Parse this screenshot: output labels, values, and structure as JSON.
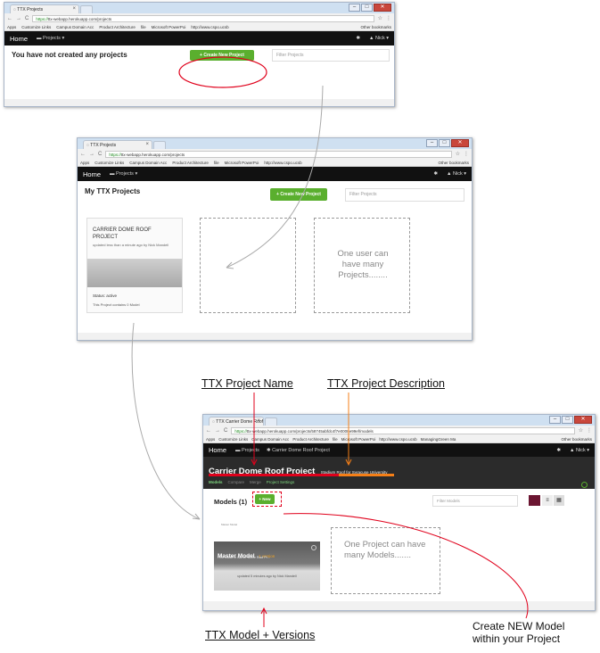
{
  "screen1": {
    "tab_title": "TTX Projects",
    "url_secure": "https://",
    "url_rest": "ttx-webapp.herokuapp.com/projects",
    "bookmarks": [
      "Apps",
      "Customize Links",
      "Campus Domain Acc",
      "Product Architecture",
      "file",
      "Microsoft PowerPoi",
      "http://www.cspo.ucsb"
    ],
    "other_bookmarks": "Other bookmarks",
    "nav_home": "Home",
    "nav_projects": "Projects",
    "nav_user": "Nick",
    "heading": "You have not created any projects",
    "create_btn": "+ Create New Project",
    "filter_placeholder": "Filter Projects"
  },
  "screen2": {
    "tab_title": "TTX Projects",
    "url_secure": "https://",
    "url_rest": "ttx-webapp.herokuapp.com/projects",
    "bookmarks": [
      "Apps",
      "Customize Links",
      "Campus Domain Acc",
      "Product Architecture",
      "file",
      "Microsoft PowerPoi",
      "http://www.cspo.ucsb"
    ],
    "other_bookmarks": "Other bookmarks",
    "nav_home": "Home",
    "nav_projects": "Projects",
    "nav_user": "Nick",
    "heading": "My TTX Projects",
    "create_btn": "+ Create New Project",
    "filter_placeholder": "Filter Projects",
    "card_title": "CARRIER DOME ROOF PROJECT",
    "card_sub": "updated less than a minute ago by Nick Mandell",
    "card_status": "Status: active",
    "card_count": "This Project contains 0 Model",
    "note": "One user can have many Projects........"
  },
  "screen3": {
    "tab_title": "TTX Carrier Dome Roof",
    "url_secure": "https://",
    "url_rest": "ttx-webapp.herokuapp.com/projects/58745abfdc4f7e0008e99ef/models",
    "bookmarks": [
      "Apps",
      "Customize Links",
      "Campus Domain Acc",
      "Product Architecture",
      "file",
      "Microsoft PowerPoi",
      "http://www.cspo.ucsb",
      "ManagingGreen Ma"
    ],
    "other_bookmarks": "Other bookmarks",
    "nav_home": "Home",
    "nav_projects": "Projects",
    "nav_crumb": "Carrier Dome Roof Project",
    "nav_user": "Nick",
    "project_name": "Carrier Dome Roof Project",
    "project_desc": "Stadium Roof for Syracuse University",
    "subnav": [
      "Models",
      "Compare",
      "Merge",
      "Project Settings"
    ],
    "models_heading": "Models (1)",
    "new_btn": "+ New",
    "filter_placeholder": "Filter Models",
    "mini_text": "Master Model",
    "model_title": "Master Model",
    "model_badge": "1 version",
    "model_desc": "First Model in Carrier Dome Roof Pr...",
    "model_updated": "updated 5 minutes ago by Nick Mandell",
    "note": "One Project can have many Models......."
  },
  "annotations": {
    "project_name_label": "TTX Project Name",
    "project_desc_label": "TTX Project Description",
    "model_versions_label": "TTX Model + Versions",
    "create_model_note": "Create NEW Model within your Project"
  },
  "colors": {
    "accent_green": "#5aaf2e",
    "annotation_red": "#e0001b",
    "annotation_orange": "#f57f17",
    "nav_dark": "#111111"
  }
}
